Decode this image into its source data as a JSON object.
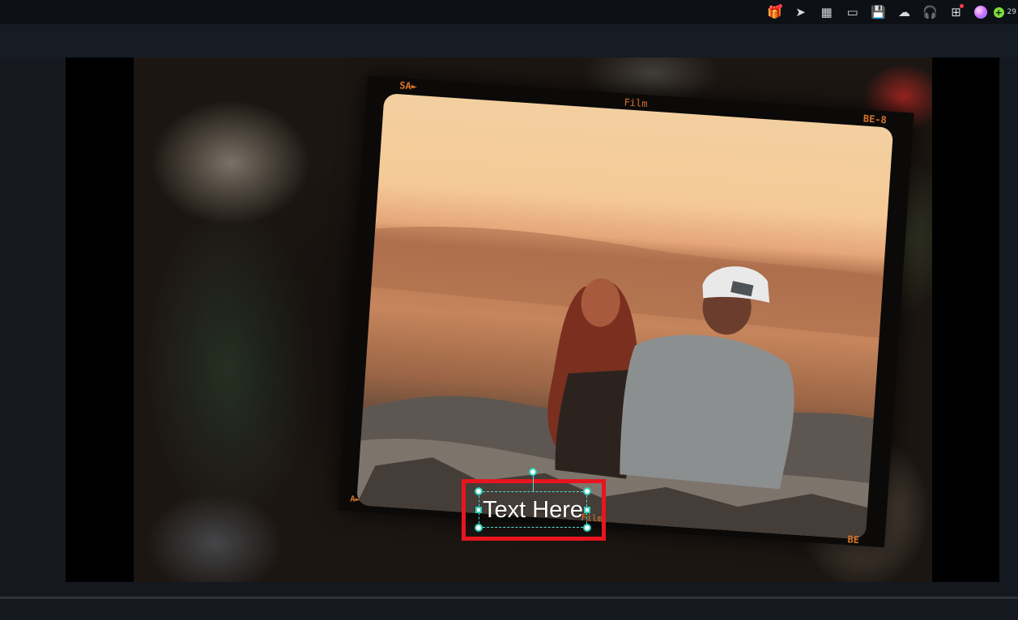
{
  "toolbar": {
    "icons": [
      {
        "name": "gift-icon",
        "glyph": "🎁",
        "notify": true
      },
      {
        "name": "send-icon",
        "glyph": "➤",
        "notify": false
      },
      {
        "name": "task-icon",
        "glyph": "▦",
        "notify": false
      },
      {
        "name": "layout-icon",
        "glyph": "▭",
        "notify": false
      },
      {
        "name": "save-icon",
        "glyph": "💾",
        "notify": false
      },
      {
        "name": "cloud-upload-icon",
        "glyph": "☁",
        "notify": false
      },
      {
        "name": "headset-icon",
        "glyph": "🎧",
        "notify": false
      },
      {
        "name": "apps-grid-icon",
        "glyph": "⊞",
        "notify": true
      }
    ],
    "credits": "29"
  },
  "film_labels": {
    "top_left": "SA►",
    "top_center": "Film",
    "top_right": "BE-8",
    "bottom_left": "A►",
    "bottom_center": "Film",
    "bottom_right": "BE"
  },
  "text_overlay": {
    "content": "Text Here"
  },
  "colors": {
    "selection_red": "#e8151f",
    "handle_teal": "#2fd0b9",
    "film_orange": "#d9742a"
  }
}
